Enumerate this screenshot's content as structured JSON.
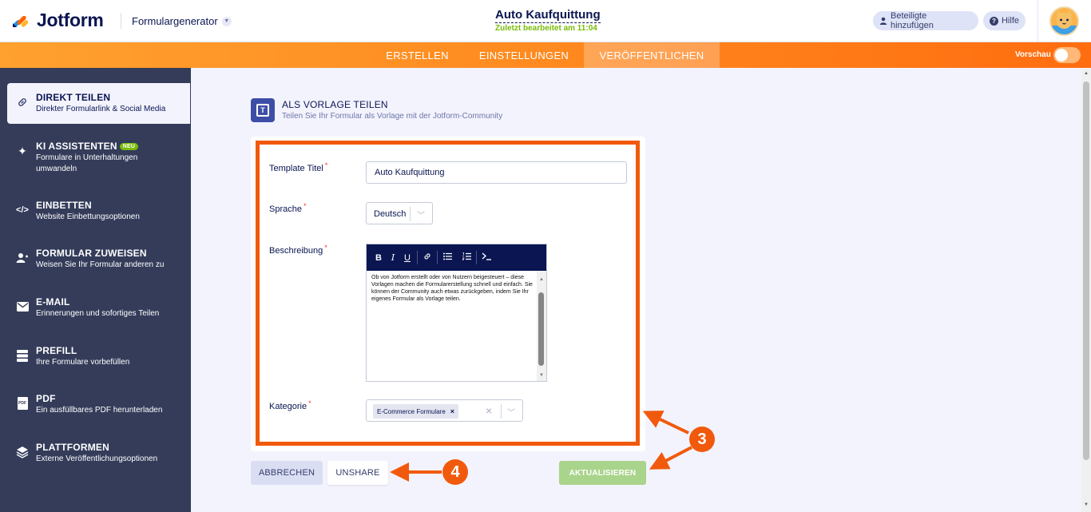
{
  "header": {
    "logo_text": "Jotform",
    "product": "Formulargenerator",
    "form_title": "Auto Kaufquittung",
    "form_status": "Zuletzt bearbeitet am 11:04",
    "invite_label": "Beteiligte hinzufügen",
    "help_label": "Hilfe",
    "help_icon_text": "?"
  },
  "nav": {
    "tabs": [
      {
        "label": "ERSTELLEN"
      },
      {
        "label": "EINSTELLUNGEN"
      },
      {
        "label": "VERÖFFENTLICHEN"
      }
    ],
    "preview_label": "Vorschau"
  },
  "sidebar": {
    "items": [
      {
        "title": "DIREKT TEILEN",
        "desc": "Direkter Formularlink & Social Media",
        "icon": "link-icon"
      },
      {
        "title": "KI ASSISTENTEN",
        "badge": "NEU",
        "desc": "Formulare in Unterhaltungen umwandeln",
        "icon": "sparkle-icon"
      },
      {
        "title": "EINBETTEN",
        "desc": "Website Einbettungsoptionen",
        "icon": "code-icon"
      },
      {
        "title": "FORMULAR ZUWEISEN",
        "desc": "Weisen Sie Ihr Formular anderen zu",
        "icon": "assign-user-icon"
      },
      {
        "title": "E-MAIL",
        "desc": "Erinnerungen und sofortiges Teilen",
        "icon": "envelope-icon"
      },
      {
        "title": "PREFILL",
        "desc": "Ihre Formulare vorbefüllen",
        "icon": "prefill-icon"
      },
      {
        "title": "PDF",
        "desc": "Ein ausfüllbares PDF herunterladen",
        "icon": "pdf-icon",
        "icon_text": "PDF"
      },
      {
        "title": "PLATTFORMEN",
        "desc": "Externe Veröffentlichungsoptionen",
        "icon": "layers-icon"
      }
    ]
  },
  "main": {
    "section_title": "ALS VORLAGE TEILEN",
    "section_desc": "Teilen Sie Ihr Formular als Vorlage mit der Jotform-Community",
    "section_icon_text": "T",
    "required_mark": "*",
    "fields": {
      "title_label": "Template Titel",
      "title_value": "Auto Kaufquittung",
      "language_label": "Sprache",
      "language_value": "Deutsch",
      "description_label": "Beschreibung",
      "description_value": "Ob von Jotform erstellt oder von Nutzern beigesteuert – diese Vorlagen machen die Formularerstellung schnell und einfach. Sie können der Community auch etwas zurückgeben, indem Sie Ihr eigenes Formular als Vorlage teilen.",
      "category_label": "Kategorie",
      "category_value": "E-Commerce Formulare",
      "chip_remove": "×",
      "clear_symbol": "×"
    },
    "toolbar": {
      "bold": "B",
      "italic": "I",
      "underline": "U"
    },
    "buttons": {
      "cancel": "ABBRECHEN",
      "unshare": "UNSHARE",
      "update": "AKTUALISIEREN"
    }
  },
  "annotations": {
    "badge_3": "3",
    "badge_4": "4",
    "color": "#f15a0c"
  },
  "colors": {
    "brand_navy": "#0a1551",
    "accent_orange": "#ff8a1f",
    "sidebar_bg": "#343c5a",
    "update_green": "#a9d48b"
  }
}
